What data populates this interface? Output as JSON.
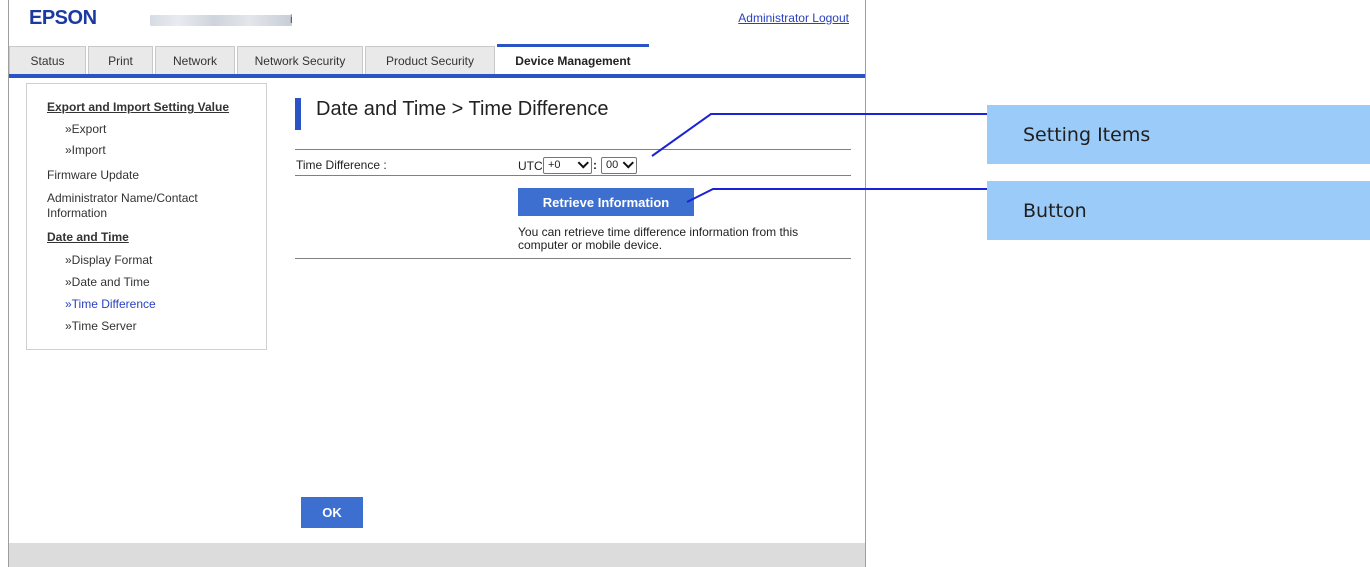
{
  "header": {
    "logo": "EPSON",
    "printer_name_suffix": "i",
    "logout_label": "Administrator Logout"
  },
  "tabs": [
    {
      "label": "Status"
    },
    {
      "label": "Print"
    },
    {
      "label": "Network"
    },
    {
      "label": "Network Security"
    },
    {
      "label": "Product Security"
    },
    {
      "label": "Device Management",
      "active": true
    }
  ],
  "sidebar": {
    "items": [
      {
        "label": "Export and Import Setting Value"
      },
      {
        "label": "»Export"
      },
      {
        "label": "»Import"
      },
      {
        "label": "Firmware Update"
      },
      {
        "label": "Administrator Name/Contact"
      },
      {
        "label": "Information"
      },
      {
        "label": "Date and Time"
      },
      {
        "label": "»Display Format"
      },
      {
        "label": "»Date and Time"
      },
      {
        "label": "»Time Difference",
        "current": true
      },
      {
        "label": "»Time Server"
      }
    ]
  },
  "main": {
    "title": "Date and Time > Time Difference",
    "field_label": "Time Difference :",
    "utc_label": "UTC",
    "hour_value": "+0",
    "colon": ":",
    "minute_value": "00",
    "retrieve_label": "Retrieve Information",
    "retrieve_note": "You can retrieve time difference information from this computer or mobile device.",
    "ok_label": "OK"
  },
  "callouts": {
    "setting_items": "Setting Items",
    "button": "Button"
  },
  "colors": {
    "accent": "#2a54c6",
    "button": "#3d6fd0",
    "callout": "#9bcbf9",
    "link": "#2a40c0"
  }
}
